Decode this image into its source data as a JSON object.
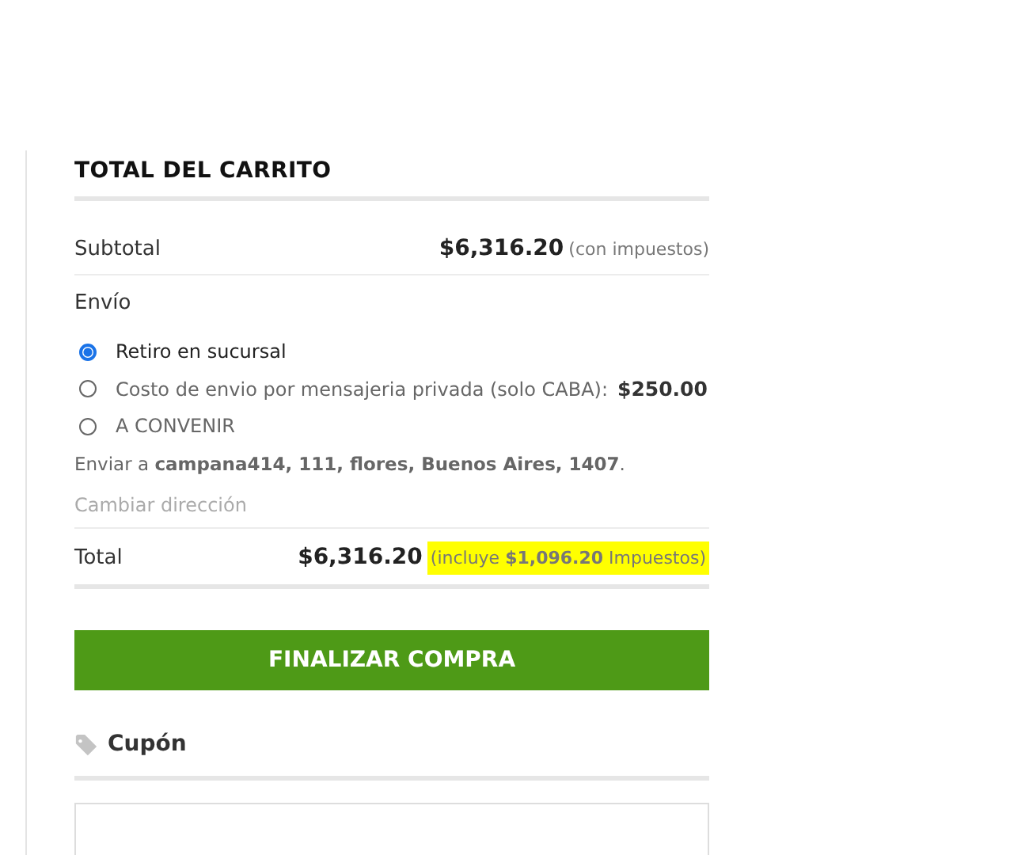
{
  "cart_totals": {
    "title": "TOTAL DEL CARRITO",
    "subtotal": {
      "label": "Subtotal",
      "amount": "$6,316.20",
      "note": "(con impuestos)"
    },
    "shipping": {
      "label": "Envío",
      "options": [
        {
          "label": "Retiro en sucursal",
          "selected": true
        },
        {
          "label": "Costo de envio por mensajeria privada (solo CABA):",
          "price": "$250.00",
          "selected": false
        },
        {
          "label": "A CONVENIR",
          "selected": false
        }
      ],
      "destination": "Enviar a **campana414, 111, flores, Buenos Aires, 1407**.",
      "change_address": "Cambiar dirección"
    },
    "total": {
      "label": "Total",
      "amount": "$6,316.20",
      "note": "(incluye **$1,096.20** Impuestos)",
      "highlighted": true
    },
    "checkout_button": "FINALIZAR COMPRA"
  },
  "coupon": {
    "title": "Cupón"
  }
}
